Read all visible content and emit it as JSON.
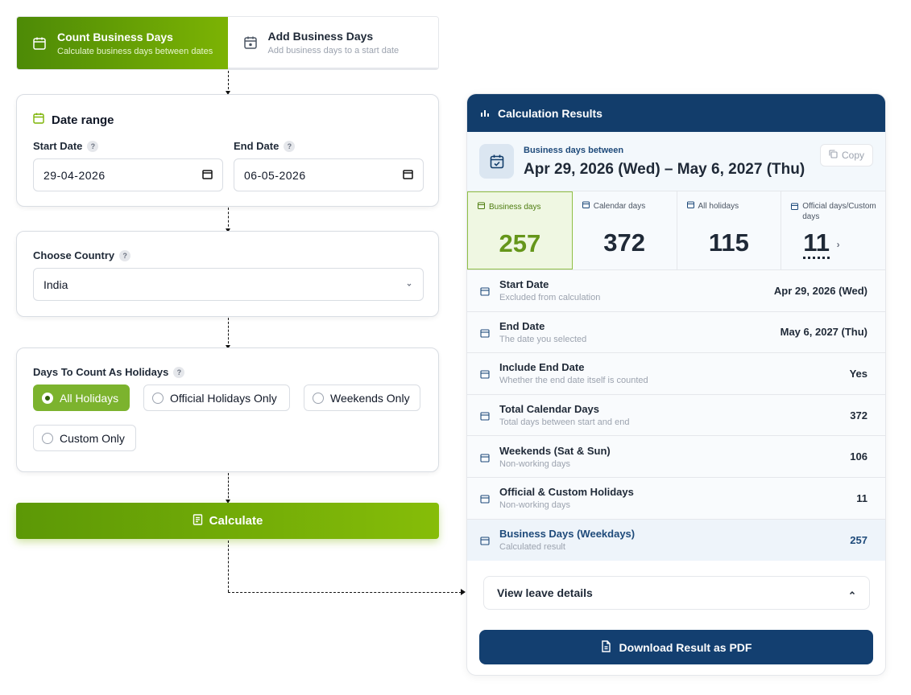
{
  "tabs": [
    {
      "title": "Count Business Days",
      "subtitle": "Calculate business days between dates"
    },
    {
      "title": "Add Business Days",
      "subtitle": "Add business days to a start date"
    }
  ],
  "date_range": {
    "title": "Date range",
    "start_label": "Start Date",
    "start_value": "29-04-2026",
    "end_label": "End Date",
    "end_value": "06-05-2026",
    "help": "?"
  },
  "country": {
    "label": "Choose Country",
    "value": "India",
    "help": "?"
  },
  "holidays": {
    "label": "Days To Count As Holidays",
    "help": "?",
    "options": [
      "All Holidays",
      "Official Holidays Only",
      "Weekends Only",
      "Custom Only"
    ],
    "selected": "All Holidays"
  },
  "calculate_label": "Calculate",
  "results": {
    "header": "Calculation Results",
    "between_label": "Business days between",
    "between_range": "Apr 29, 2026 (Wed) – May 6, 2027 (Thu)",
    "copy_label": "Copy",
    "stats": [
      {
        "label": "Business days",
        "value": "257"
      },
      {
        "label": "Calendar days",
        "value": "372"
      },
      {
        "label": "All holidays",
        "value": "115"
      },
      {
        "label": "Official days/Custom days",
        "value": "11"
      }
    ],
    "rows": [
      {
        "title": "Start Date",
        "sub": "Excluded from calculation",
        "value": "Apr 29, 2026 (Wed)"
      },
      {
        "title": "End Date",
        "sub": "The date you selected",
        "value": "May 6, 2027 (Thu)"
      },
      {
        "title": "Include End Date",
        "sub": "Whether the end date itself is counted",
        "value": "Yes"
      },
      {
        "title": "Total Calendar Days",
        "sub": "Total days between start and end",
        "value": "372"
      },
      {
        "title": "Weekends (Sat & Sun)",
        "sub": "Non-working days",
        "value": "106"
      },
      {
        "title": "Official & Custom Holidays",
        "sub": "Non-working days",
        "value": "11"
      },
      {
        "title": "Business Days (Weekdays)",
        "sub": "Calculated result",
        "value": "257"
      }
    ],
    "leave_label": "View leave details",
    "pdf_label": "Download Result as PDF"
  },
  "colors": {
    "accent_green": "#7cb304",
    "accent_navy": "#123d6b"
  }
}
